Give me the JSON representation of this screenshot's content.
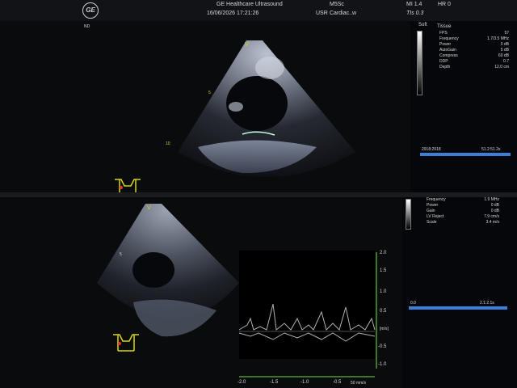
{
  "top_monitor": {
    "header": {
      "brand": "GE Healthcare Ultrasound",
      "datetime": "16/06/2026 17:21:26",
      "probe": "M5Sc",
      "operator": "USR",
      "preset": "Cardiac..w",
      "mi": "MI 1.4",
      "tis": "TIs 0.3",
      "heart_rate": "HR 0"
    },
    "left_label": "ND",
    "depth_marker": "10",
    "depth_marker_5": "5",
    "apex_marker": "V",
    "gray_label": "Soft",
    "params_title": "Tissue",
    "params": [
      {
        "label": "FPS",
        "value": "57"
      },
      {
        "label": "Frequency",
        "value": "1.7/3.5 MHz"
      },
      {
        "label": "Power",
        "value": "0 dB"
      },
      {
        "label": "AutoGain",
        "value": "5 dB"
      },
      {
        "label": "Compress",
        "value": "60 dB"
      },
      {
        "label": "DDP",
        "value": "0.7"
      },
      {
        "label": "Depth",
        "value": "12.0 cm"
      }
    ],
    "cine": {
      "left": "2918:2918",
      "right": "51.2:51.2s",
      "progress": 1.0
    }
  },
  "bottom_monitor": {
    "params": [
      {
        "label": "Frequency",
        "value": "1.9 MHz"
      },
      {
        "label": "Power",
        "value": "0 dB"
      },
      {
        "label": "Gain",
        "value": "0 dB"
      },
      {
        "label": "LV Reject",
        "value": "7.9 cm/s"
      },
      {
        "label": "Scale",
        "value": "3.4 m/s"
      }
    ],
    "apex_marker": "V",
    "depth_marker_5": "5",
    "cine": {
      "left": "0.0",
      "right": "2.1:2.1s",
      "progress": 1.0
    },
    "velocity_unit": "[m/s]",
    "velocity_ticks": [
      "-2.0",
      "-1.5",
      "-1.0",
      "-0.5",
      "0.5",
      "1.0",
      "1.5",
      "2.0"
    ],
    "time_ticks": [
      "-2.0",
      "-1.5",
      "-1.0",
      "-0.5"
    ],
    "speed_label": "50 mm/s"
  },
  "colors": {
    "accent_bar": "#3b7fd8",
    "marker": "#d8d800",
    "velocity_axis": "#7ad84a"
  }
}
